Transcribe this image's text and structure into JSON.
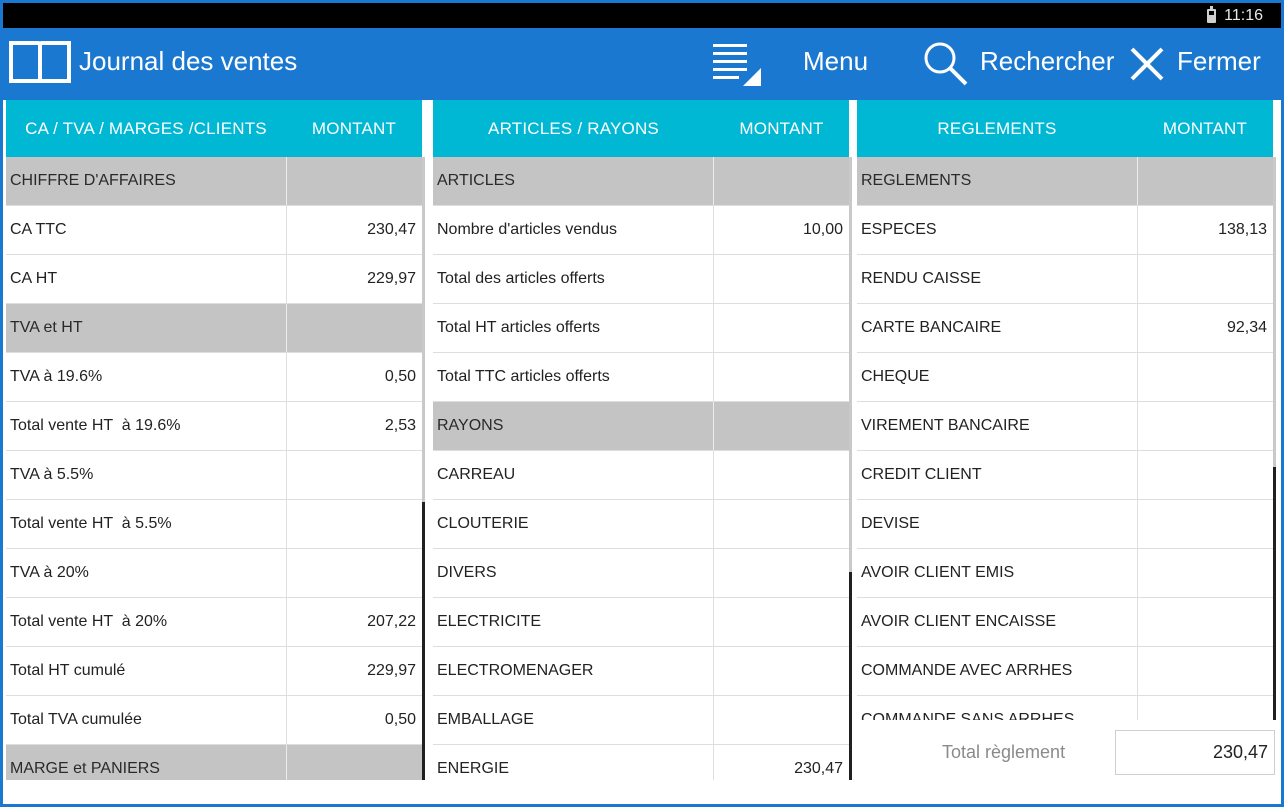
{
  "status_bar": {
    "time": "11:16"
  },
  "app_bar": {
    "title": "Journal des ventes",
    "menu_label": "Menu",
    "search_label": "Rechercher",
    "close_label": "Fermer",
    "accent_color": "#1b78d0"
  },
  "panels": {
    "ca": {
      "header_label": "CA / TVA / MARGES /CLIENTS",
      "header_amount": "MONTANT",
      "rows": [
        {
          "label": "CHIFFRE D'AFFAIRES",
          "amount": "",
          "section": true
        },
        {
          "label": "CA TTC",
          "amount": "230,47",
          "section": false
        },
        {
          "label": "CA HT",
          "amount": "229,97",
          "section": false
        },
        {
          "label": "TVA et HT",
          "amount": "",
          "section": true
        },
        {
          "label": "TVA à 19.6%",
          "amount": "0,50",
          "section": false
        },
        {
          "label": "Total vente HT  à 19.6%",
          "amount": "2,53",
          "section": false
        },
        {
          "label": "TVA à 5.5%",
          "amount": "",
          "section": false
        },
        {
          "label": "Total vente HT  à 5.5%",
          "amount": "",
          "section": false
        },
        {
          "label": "TVA à 20%",
          "amount": "",
          "section": false
        },
        {
          "label": "Total vente HT  à 20%",
          "amount": "207,22",
          "section": false
        },
        {
          "label": "Total HT cumulé",
          "amount": "229,97",
          "section": false
        },
        {
          "label": "Total TVA cumulée",
          "amount": "0,50",
          "section": false
        },
        {
          "label": "MARGE et PANIERS",
          "amount": "",
          "section": true
        }
      ]
    },
    "articles": {
      "header_label": "ARTICLES / RAYONS",
      "header_amount": "MONTANT",
      "rows": [
        {
          "label": "ARTICLES",
          "amount": "",
          "section": true
        },
        {
          "label": "Nombre d'articles vendus",
          "amount": "10,00",
          "section": false
        },
        {
          "label": "Total des articles offerts",
          "amount": "",
          "section": false
        },
        {
          "label": "Total HT articles offerts",
          "amount": "",
          "section": false
        },
        {
          "label": "Total TTC articles offerts",
          "amount": "",
          "section": false
        },
        {
          "label": "RAYONS",
          "amount": "",
          "section": true
        },
        {
          "label": "CARREAU",
          "amount": "",
          "section": false
        },
        {
          "label": "CLOUTERIE",
          "amount": "",
          "section": false
        },
        {
          "label": "DIVERS",
          "amount": "",
          "section": false
        },
        {
          "label": "ELECTRICITE",
          "amount": "",
          "section": false
        },
        {
          "label": "ELECTROMENAGER",
          "amount": "",
          "section": false
        },
        {
          "label": "EMBALLAGE",
          "amount": "",
          "section": false
        },
        {
          "label": "ENERGIE",
          "amount": "230,47",
          "section": false
        }
      ]
    },
    "reglements": {
      "header_label": "REGLEMENTS",
      "header_amount": "MONTANT",
      "rows": [
        {
          "label": "REGLEMENTS",
          "amount": "",
          "section": true
        },
        {
          "label": "ESPECES",
          "amount": "138,13",
          "section": false
        },
        {
          "label": "RENDU CAISSE",
          "amount": "",
          "section": false
        },
        {
          "label": "CARTE BANCAIRE",
          "amount": "92,34",
          "section": false
        },
        {
          "label": "CHEQUE",
          "amount": "",
          "section": false
        },
        {
          "label": "VIREMENT BANCAIRE",
          "amount": "",
          "section": false
        },
        {
          "label": "CREDIT CLIENT",
          "amount": "",
          "section": false
        },
        {
          "label": "DEVISE",
          "amount": "",
          "section": false
        },
        {
          "label": "AVOIR CLIENT EMIS",
          "amount": "",
          "section": false
        },
        {
          "label": "AVOIR CLIENT ENCAISSE",
          "amount": "",
          "section": false
        },
        {
          "label": "COMMANDE AVEC ARRHES",
          "amount": "",
          "section": false
        },
        {
          "label": "COMMANDE SANS ARRHES",
          "amount": "",
          "section": false
        }
      ],
      "footer_label": "Total règlement",
      "footer_value": "230,47"
    }
  }
}
